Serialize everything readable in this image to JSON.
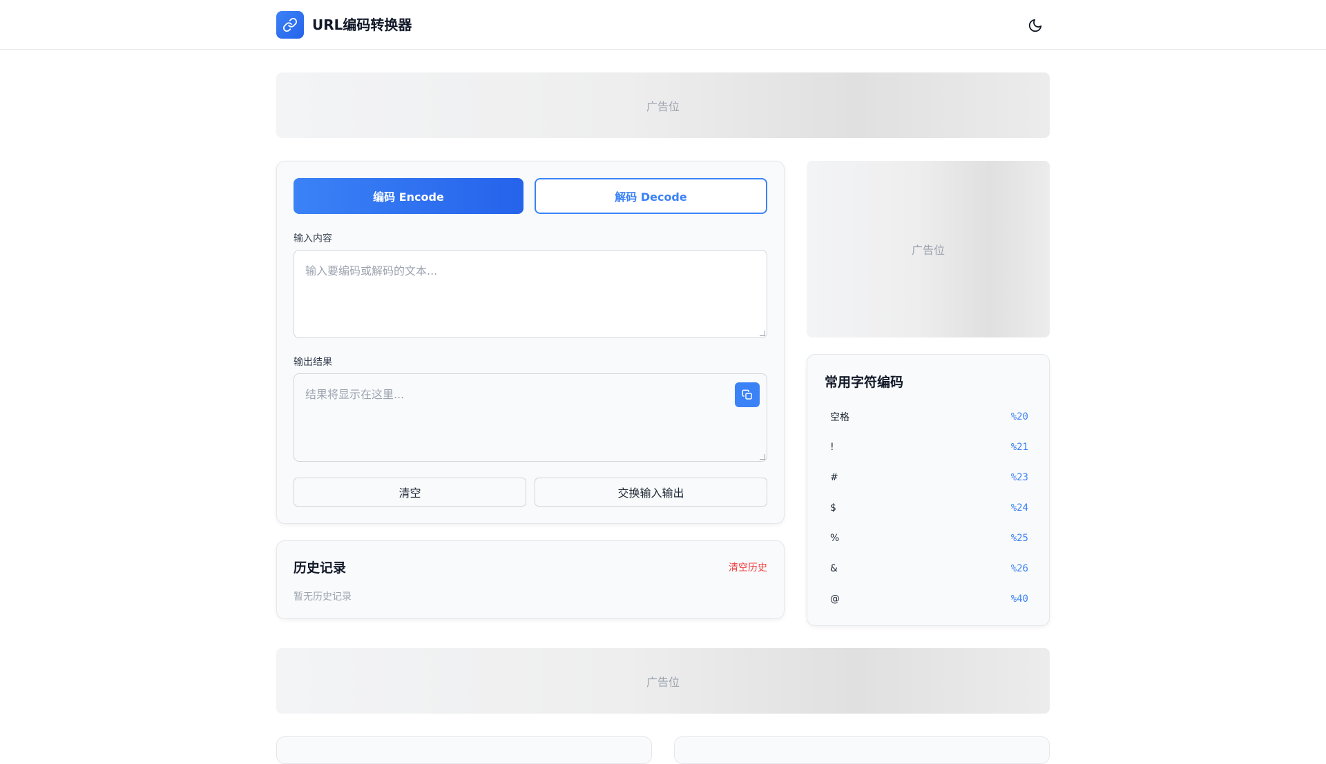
{
  "header": {
    "app_title": "URL编码转换器",
    "logo_icon": "link-icon",
    "theme_icon": "moon-icon"
  },
  "ads": {
    "top_label": "广告位",
    "side_label": "广告位",
    "bottom_label": "广告位"
  },
  "converter": {
    "encode_label": "编码 Encode",
    "decode_label": "解码 Decode",
    "active_mode": "encode",
    "input_label": "输入内容",
    "input_placeholder": "输入要编码或解码的文本...",
    "input_value": "",
    "output_label": "输出结果",
    "output_placeholder": "结果将显示在这里...",
    "output_value": "",
    "copy_icon": "copy-icon",
    "clear_label": "清空",
    "swap_label": "交换输入输出"
  },
  "history": {
    "title": "历史记录",
    "clear_label": "清空历史",
    "empty_text": "暂无历史记录"
  },
  "common_chars": {
    "title": "常用字符编码",
    "items": [
      {
        "char": "空格",
        "code": "%20"
      },
      {
        "char": "!",
        "code": "%21"
      },
      {
        "char": "#",
        "code": "%23"
      },
      {
        "char": "$",
        "code": "%24"
      },
      {
        "char": "%",
        "code": "%25"
      },
      {
        "char": "&",
        "code": "%26"
      },
      {
        "char": "@",
        "code": "%40"
      }
    ]
  },
  "colors": {
    "accent": "#3b82f6",
    "danger": "#ef4444"
  }
}
